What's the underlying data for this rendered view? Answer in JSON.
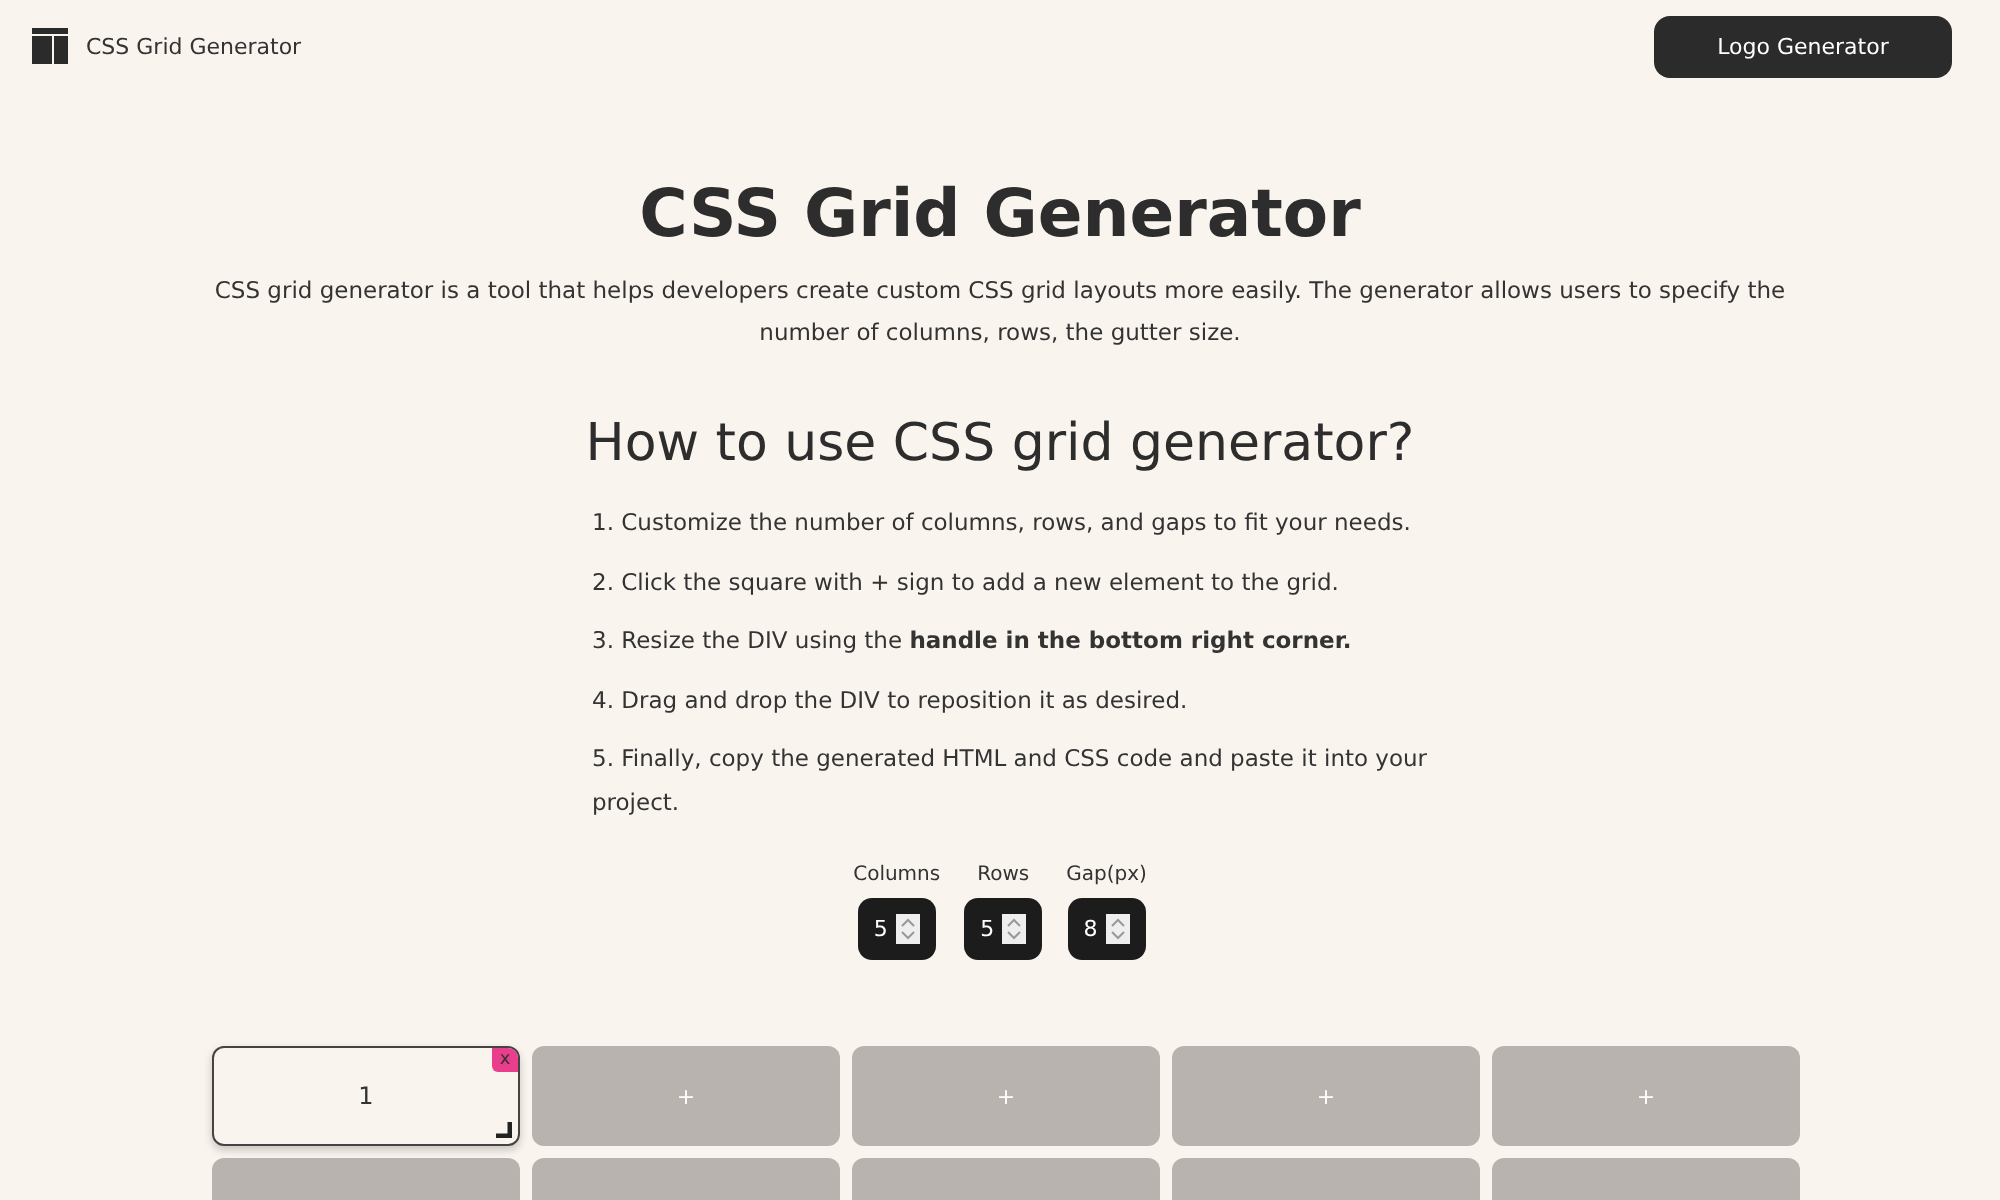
{
  "header": {
    "brand": "CSS Grid Generator",
    "button": "Logo Generator"
  },
  "title": "CSS Grid Generator",
  "description": "CSS grid generator is a tool that helps developers create custom CSS grid layouts more easily. The generator allows users to specify the number of columns, rows, the gutter size.",
  "howto": {
    "heading": "How to use CSS grid generator?",
    "steps": [
      "1. Customize the number of columns, rows, and gaps to fit your needs.",
      "2. Click the square with + sign to add a new element to the grid.",
      "3. Resize the DIV using the **handle in the bottom right corner.**",
      "4. Drag and drop the DIV to reposition it as desired.",
      "5. Finally, copy the generated HTML and CSS code and paste it into your project."
    ]
  },
  "controls": [
    {
      "label": "Columns",
      "value": "5"
    },
    {
      "label": "Rows",
      "value": "5"
    },
    {
      "label": "Gap(px)",
      "value": "8"
    }
  ],
  "grid": {
    "cells": [
      {
        "kind": "item",
        "label": "1",
        "close": "x"
      },
      {
        "kind": "add",
        "label": "+"
      },
      {
        "kind": "add",
        "label": "+"
      },
      {
        "kind": "add",
        "label": "+"
      },
      {
        "kind": "add",
        "label": "+"
      },
      {
        "kind": "blank"
      },
      {
        "kind": "blank"
      },
      {
        "kind": "blank"
      },
      {
        "kind": "blank"
      },
      {
        "kind": "blank"
      }
    ]
  }
}
